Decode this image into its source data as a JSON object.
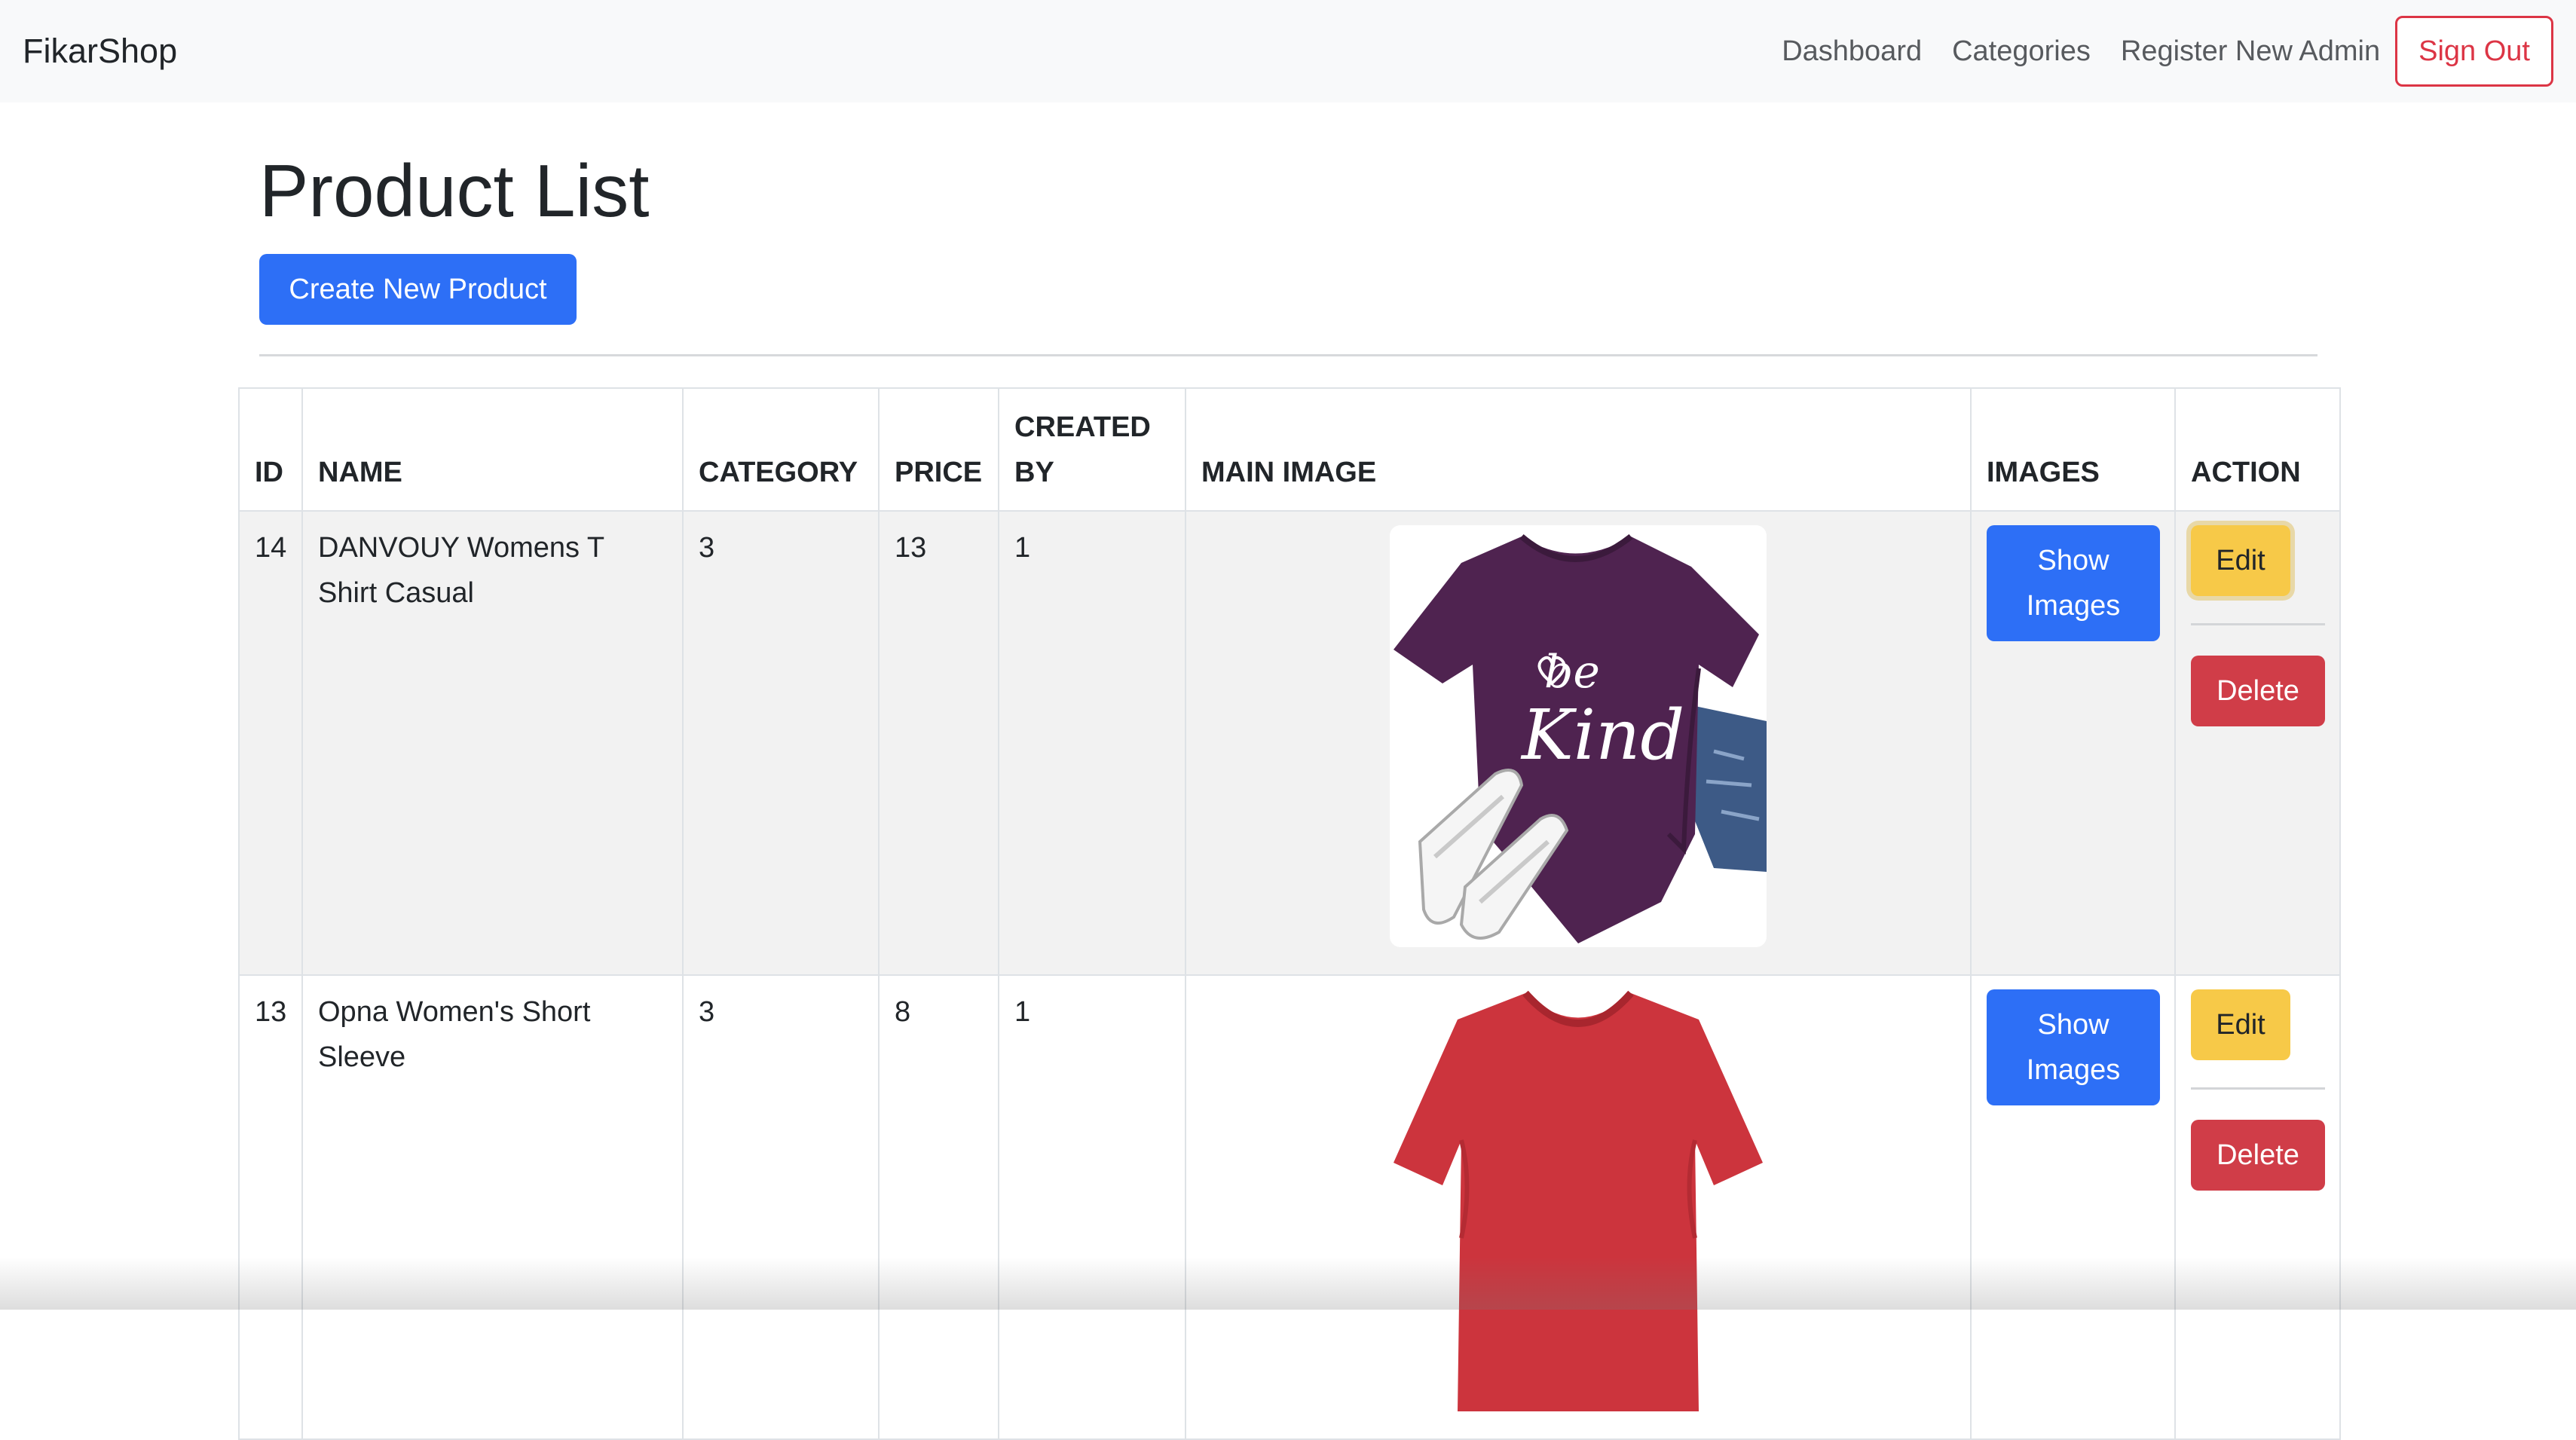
{
  "navbar": {
    "brand": "FikarShop",
    "links": [
      "Dashboard",
      "Categories",
      "Register New Admin"
    ],
    "sign_out": "Sign Out"
  },
  "page": {
    "title": "Product List",
    "create_button": "Create New Product"
  },
  "table": {
    "headers": {
      "id": "ID",
      "name": "NAME",
      "category": "CATEGORY",
      "price": "PRICE",
      "created_by": "CREATED BY",
      "main_image": "MAIN IMAGE",
      "images": "IMAGES",
      "action": "ACTION"
    },
    "rows": [
      {
        "id": "14",
        "name": "DANVOUY Womens T Shirt Casual",
        "category": "3",
        "price": "13",
        "created_by": "1",
        "main_image_icon": "purple-be-kind-tshirt-image",
        "image_text_1": "be",
        "image_text_2": "Kind",
        "show_images": "Show Images",
        "edit": "Edit",
        "delete": "Delete"
      },
      {
        "id": "13",
        "name": "Opna Women's Short Sleeve",
        "category": "3",
        "price": "8",
        "created_by": "1",
        "main_image_icon": "red-vneck-tshirt-image",
        "show_images": "Show Images",
        "edit": "Edit",
        "delete": "Delete"
      }
    ]
  },
  "colors": {
    "primary": "#2d6ff6",
    "warning": "#f7c948",
    "danger": "#d03d48",
    "navbar_bg": "#f8f9fa",
    "shirt_purple": "#4f2350",
    "shirt_red": "#cc343d"
  }
}
